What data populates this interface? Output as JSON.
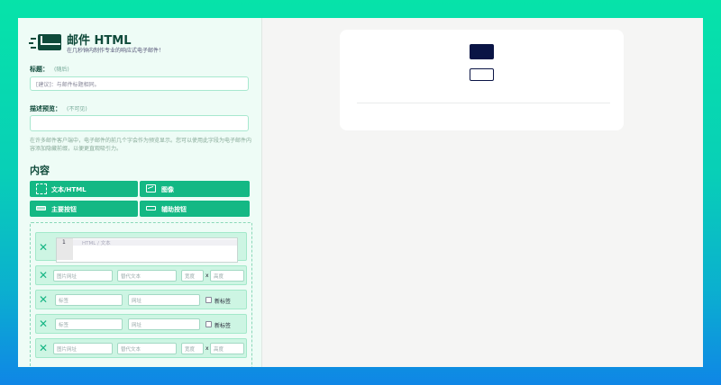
{
  "header": {
    "title": "邮件 HTML",
    "subtitle": "在几秒钟内制作专业的响应式电子邮件！"
  },
  "form": {
    "subject_label": "标题：",
    "subject_hint": "(随后)",
    "subject_placeholder": "[建议]：与邮件标题相同。",
    "preheader_label": "描述预览：",
    "preheader_hint": "(不可见)",
    "preheader_value": "",
    "preheader_desc": "在许多邮件客户端中，电子邮件的前几个字会作为预览显示。您可以使用此字段为电子邮件内容添加隐藏前缀，以便更直观吸引力。"
  },
  "content": {
    "heading": "内容",
    "add_buttons": [
      {
        "label": "文本/HTML",
        "icon": "text-icon"
      },
      {
        "label": "图像",
        "icon": "image-icon"
      },
      {
        "label": "主要按钮",
        "icon": "primary-button-icon"
      },
      {
        "label": "辅助按钮",
        "icon": "secondary-button-icon"
      }
    ],
    "blocks": {
      "text": {
        "remove": "✕",
        "line_number": "1",
        "placeholder": "HTML / 文本"
      },
      "image1": {
        "remove": "✕",
        "url_ph": "图片网址",
        "alt_ph": "替代文本",
        "width_ph": "宽度",
        "times": "x",
        "height_ph": "高度"
      },
      "button1": {
        "remove": "✕",
        "label_ph": "标签",
        "url_ph": "网址",
        "newtab": "新标签"
      },
      "button2": {
        "remove": "✕",
        "label_ph": "标签",
        "url_ph": "网址",
        "newtab": "新标签"
      },
      "image2": {
        "remove": "✕",
        "url_ph": "图片网址",
        "alt_ph": "替代文本",
        "width_ph": "宽度",
        "times": "x",
        "height_ph": "高度"
      }
    }
  },
  "colors": {
    "accent": "#14b884",
    "brand_dark": "#0f4a3a",
    "preview_button": "#0a1445"
  }
}
